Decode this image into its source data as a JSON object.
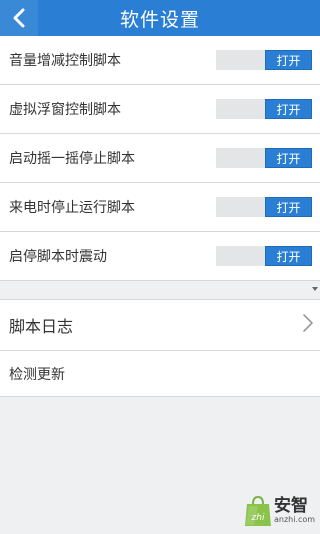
{
  "header": {
    "title": "软件设置"
  },
  "settings": [
    {
      "label": "音量增减控制脚本",
      "button": "打开"
    },
    {
      "label": "虚拟浮窗控制脚本",
      "button": "打开"
    },
    {
      "label": "启动摇一摇停止脚本",
      "button": "打开"
    },
    {
      "label": "来电时停止运行脚本",
      "button": "打开"
    },
    {
      "label": "启停脚本时震动",
      "button": "打开"
    }
  ],
  "menu": {
    "log_label": "脚本日志",
    "update_label": "检测更新"
  },
  "watermark": {
    "name": "安智",
    "domain": "anzhi.com"
  },
  "colors": {
    "accent": "#2a7fd4",
    "background": "#eef0f2"
  }
}
